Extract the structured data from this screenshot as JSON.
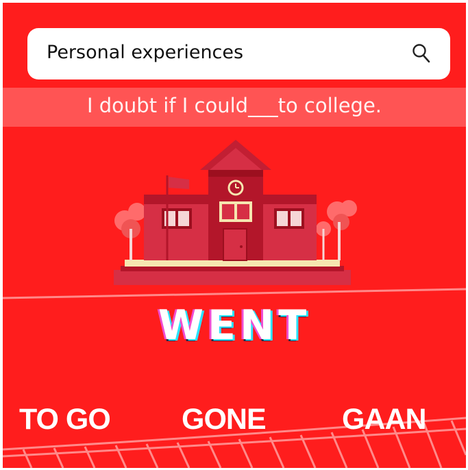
{
  "search": {
    "value": "Personal experiences",
    "icon": "search-icon"
  },
  "question": {
    "sentence": "I doubt if I could___to college."
  },
  "answer": {
    "word": "WENT"
  },
  "options": [
    {
      "label": "TO GO"
    },
    {
      "label": "GONE"
    },
    {
      "label": "GAAN"
    }
  ],
  "illustration": {
    "subject": "school-building"
  },
  "colors": {
    "background": "#ff1d1d",
    "band": "#ff5454",
    "building": "#d62f45",
    "building_dark": "#b3162a",
    "trim": "#f6e6b0",
    "answer_glitch_pink": "#f04dd2",
    "answer_glitch_cyan": "#2be3ff"
  }
}
